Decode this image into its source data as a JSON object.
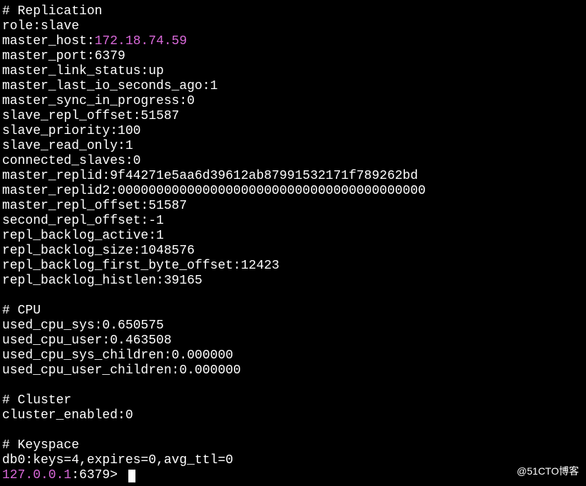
{
  "sections": {
    "replication": {
      "header": "# Replication",
      "fields": {
        "role": "role:slave",
        "master_host_key": "master_host:",
        "master_host_val": "172.18.74.59",
        "master_port": "master_port:6379",
        "master_link_status": "master_link_status:up",
        "master_last_io_seconds_ago": "master_last_io_seconds_ago:1",
        "master_sync_in_progress": "master_sync_in_progress:0",
        "slave_repl_offset": "slave_repl_offset:51587",
        "slave_priority": "slave_priority:100",
        "slave_read_only": "slave_read_only:1",
        "connected_slaves": "connected_slaves:0",
        "master_replid": "master_replid:9f44271e5aa6d39612ab87991532171f789262bd",
        "master_replid2": "master_replid2:0000000000000000000000000000000000000000",
        "master_repl_offset": "master_repl_offset:51587",
        "second_repl_offset": "second_repl_offset:-1",
        "repl_backlog_active": "repl_backlog_active:1",
        "repl_backlog_size": "repl_backlog_size:1048576",
        "repl_backlog_first_byte_offset": "repl_backlog_first_byte_offset:12423",
        "repl_backlog_histlen": "repl_backlog_histlen:39165"
      }
    },
    "cpu": {
      "header": "# CPU",
      "fields": {
        "used_cpu_sys": "used_cpu_sys:0.650575",
        "used_cpu_user": "used_cpu_user:0.463508",
        "used_cpu_sys_children": "used_cpu_sys_children:0.000000",
        "used_cpu_user_children": "used_cpu_user_children:0.000000"
      }
    },
    "cluster": {
      "header": "# Cluster",
      "fields": {
        "cluster_enabled": "cluster_enabled:0"
      }
    },
    "keyspace": {
      "header": "# Keyspace",
      "fields": {
        "db0": "db0:keys=4,expires=0,avg_ttl=0"
      }
    }
  },
  "prompt": {
    "ip": "127.0.0.1",
    "rest": ":6379> "
  },
  "watermark": "@51CTO博客"
}
